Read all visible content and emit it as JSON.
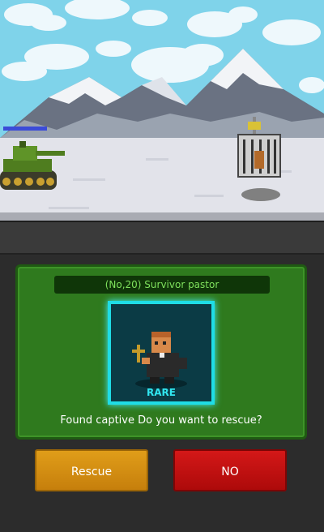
{
  "captive": {
    "title": "(No,20) Survivor pastor",
    "rarity": "RARE",
    "prompt": "Found captive Do you want to rescue?"
  },
  "buttons": {
    "rescue_label": "Rescue",
    "no_label": "NO"
  },
  "hud": {
    "player_health": 1.0
  },
  "colors": {
    "sky": "#7fd3ea",
    "dialog_green": "#2f7a1e",
    "rescue": "#e09d19",
    "no": "#d41818",
    "rarity": "#31e6f0"
  }
}
